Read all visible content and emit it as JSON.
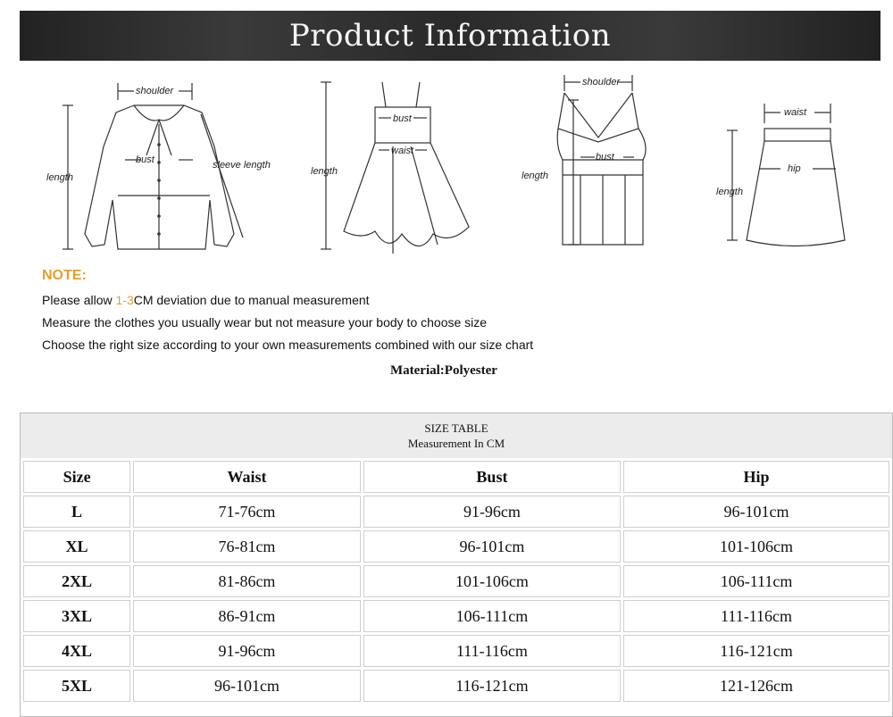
{
  "header": {
    "title": "Product Information"
  },
  "diagrams": {
    "shirt": {
      "shoulder": "shoulder",
      "bust": "bust",
      "length": "length",
      "sleeve": "sleeve length"
    },
    "dress": {
      "bust": "bust",
      "waist": "waist",
      "length": "length"
    },
    "tank": {
      "shoulder": "shoulder",
      "bust": "bust",
      "length": "length"
    },
    "skirt": {
      "waist": "waist",
      "hip": "hip",
      "length": "length"
    }
  },
  "notes": {
    "title": "NOTE:",
    "line1_prefix": "Please allow ",
    "line1_accent": "1-3",
    "line1_suffix": "CM deviation due to manual measurement",
    "line2": "Measure the clothes you usually wear but not measure your body to choose size",
    "line3": "Choose the right size according to your own measurements combined with our size chart"
  },
  "material": "Material:Polyester",
  "size_table": {
    "title": "SIZE TABLE",
    "subtitle": "Measurement In CM",
    "headers": [
      "Size",
      "Waist",
      "Bust",
      "Hip"
    ],
    "rows": [
      [
        "L",
        "71-76cm",
        "91-96cm",
        "96-101cm"
      ],
      [
        "XL",
        "76-81cm",
        "96-101cm",
        "101-106cm"
      ],
      [
        "2XL",
        "81-86cm",
        "101-106cm",
        "106-111cm"
      ],
      [
        "3XL",
        "86-91cm",
        "106-111cm",
        "111-116cm"
      ],
      [
        "4XL",
        "91-96cm",
        "111-116cm",
        "116-121cm"
      ],
      [
        "5XL",
        "96-101cm",
        "116-121cm",
        "121-126cm"
      ]
    ]
  }
}
